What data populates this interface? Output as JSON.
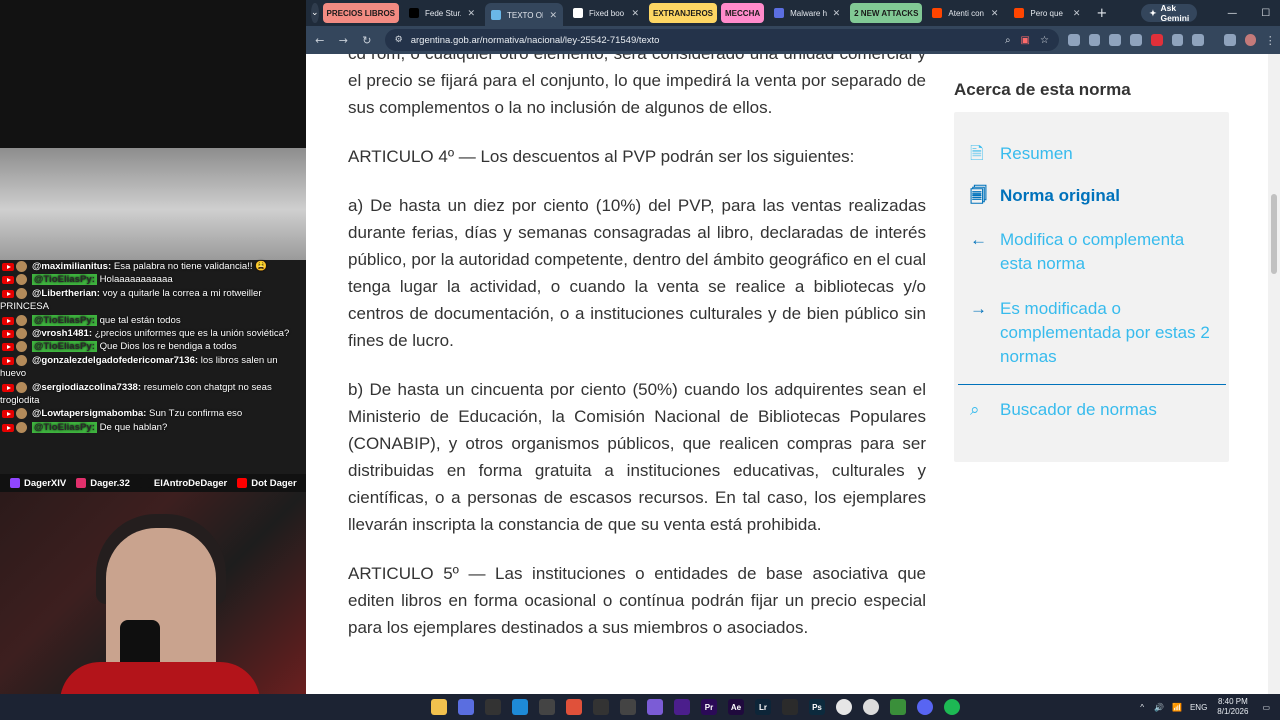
{
  "overlay": {
    "chat": [
      {
        "name": "@maximilianitus:",
        "text": "Esa palabra no tiene validancia!! 😩",
        "mod": false,
        "wrap": false
      },
      {
        "name": "@TioEliasPy:",
        "text": "Holaaaaaaaaaaa",
        "mod": true,
        "wrap": false
      },
      {
        "name": "@Libertherian:",
        "text": "voy a quitarle la correa a mi rotweiller PRINCESA",
        "mod": false,
        "wrap": true
      },
      {
        "name": "@TioEliasPy:",
        "text": "que tal están todos",
        "mod": true,
        "wrap": false
      },
      {
        "name": "@vrosh1481:",
        "text": "¿precios uniformes que es la unión soviética?",
        "mod": false,
        "wrap": true
      },
      {
        "name": "@TioEliasPy:",
        "text": "Que Dios los re bendiga a todos",
        "mod": true,
        "wrap": false
      },
      {
        "name": "@gonzalezdelgadofedericomar7136:",
        "text": "los libros salen un huevo",
        "mod": false,
        "wrap": true
      },
      {
        "name": "@sergiodiazcolina7338:",
        "text": "resumelo con chatgpt no seas troglodita",
        "mod": false,
        "wrap": true
      },
      {
        "name": "@Lowtapersigmabomba:",
        "text": "Sun Tzu confirma eso",
        "mod": false,
        "wrap": false
      },
      {
        "name": "@TioEliasPy:",
        "text": "De que hablan?",
        "mod": true,
        "wrap": false
      }
    ],
    "socials": [
      {
        "label": "DagerXIV",
        "icon": "twitch-icon",
        "color": "#9146ff"
      },
      {
        "label": "Dager.32",
        "icon": "instagram-icon",
        "color": "#e1306c"
      },
      {
        "label": "ElAntroDeDager",
        "icon": "tiktok-icon",
        "color": "#111111"
      },
      {
        "label": "Dot Dager",
        "icon": "youtube-icon",
        "color": "#ff0000"
      }
    ]
  },
  "browser": {
    "tabs": [
      {
        "type": "group",
        "label": "PRECIOS LIBROS",
        "color": "#f28b82"
      },
      {
        "type": "tab",
        "label": "Fede Stur...",
        "icon": "x-icon",
        "color": "#000000"
      },
      {
        "type": "tab",
        "label": "TEXTO OR",
        "icon": "argentina-icon",
        "color": "#6ab7e8",
        "active": true
      },
      {
        "type": "tab",
        "label": "Fixed boo",
        "icon": "wikipedia-icon",
        "color": "#ffffff"
      },
      {
        "type": "group",
        "label": "EXTRANJEROS",
        "color": "#fdd663"
      },
      {
        "type": "group",
        "label": "MECCHA",
        "color": "#ff8bcb"
      },
      {
        "type": "tab",
        "label": "Malware h",
        "icon": "site-icon",
        "color": "#5b6ee1"
      },
      {
        "type": "group",
        "label": "2 NEW ATTACKS",
        "color": "#81c995"
      },
      {
        "type": "tab",
        "label": "Atenti con",
        "icon": "reddit-icon",
        "color": "#ff4500"
      },
      {
        "type": "tab",
        "label": "Pero que",
        "icon": "reddit-icon",
        "color": "#ff4500"
      }
    ],
    "new_tab": "+",
    "gemini_label": "Ask Gemini",
    "url": "argentina.gob.ar/normativa/nacional/ley-25542-71549/texto"
  },
  "article": {
    "paragraphs": [
      "cd rom, o cualquier otro elemento, será considerado una unidad comercial y el precio se fijará para el conjunto, lo que impedirá la venta por separado de sus complementos o la no inclusión de algunos de ellos.",
      "ARTICULO 4º — Los descuentos al PVP podrán ser los siguientes:",
      "a) De hasta un diez por ciento (10%) del PVP, para las ventas realizadas durante ferias, días y semanas consagradas al libro, declaradas de interés público, por la autoridad competente, dentro del ámbito geográfico en el cual tenga lugar la actividad, o cuando la venta se realice a bibliotecas y/o centros de documentación, o a instituciones culturales y de bien público sin fines de lucro.",
      "b) De hasta un cincuenta por ciento (50%) cuando los adquirentes sean el Ministerio de Educación, la Comisión Nacional de Bibliotecas Populares (CONABIP), y otros organismos públicos, que realicen compras para ser distribuidas en forma gratuita a instituciones educativas, culturales y científicas, o a personas de escasos recursos. En tal caso, los ejemplares llevarán inscripta la constancia de que su venta está prohibida.",
      "ARTICULO 5º — Las instituciones o entidades de base asociativa que editen libros en forma ocasional o contínua podrán fijar un precio especial para los ejemplares destinados a sus miembros o asociados."
    ]
  },
  "sidebar": {
    "title": "Acerca de esta norma",
    "items": [
      {
        "label": "Resumen",
        "icon": "document-icon",
        "active": false
      },
      {
        "label": "Norma original",
        "icon": "document-search-icon",
        "active": true
      },
      {
        "label": "Modifica o complementa esta norma",
        "icon": "arrow-left-icon",
        "active": false
      },
      {
        "label": "Es modificada o complementada por estas 2 normas",
        "icon": "arrow-right-icon",
        "active": false
      },
      {
        "label": "Buscador de normas",
        "icon": "search-icon",
        "active": false
      }
    ]
  },
  "taskbar": {
    "lang": "ENG",
    "time": "8:40 PM",
    "date": "8/1/2026"
  }
}
